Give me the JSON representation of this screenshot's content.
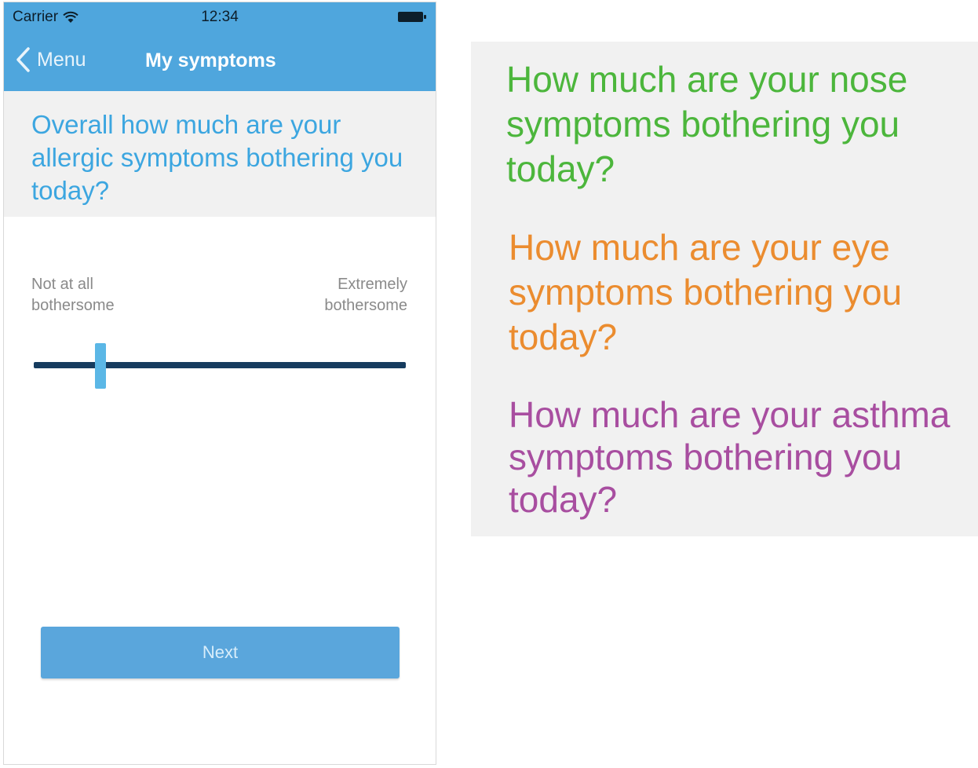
{
  "status_bar": {
    "carrier": "Carrier",
    "time": "12:34",
    "wifi_icon": "wifi-icon",
    "battery_icon": "battery-icon"
  },
  "nav_bar": {
    "back_label": "Menu",
    "back_icon": "chevron-left-icon",
    "title": "My symptoms"
  },
  "question": {
    "text": "Overall how much are your allergic symptoms bothering you today?"
  },
  "slider": {
    "min_label": "Not at all bothersome",
    "max_label": "Extremely bothersome",
    "value_fraction": 0.18
  },
  "next_button": {
    "label": "Next"
  },
  "variants": [
    {
      "text": "How much are your nose symptoms bothering you today?",
      "color": "#4cb63c"
    },
    {
      "text": "How much are your eye symptoms bothering you today?",
      "color": "#eb8c2f"
    },
    {
      "text": "How much are your asthma symptoms bothering you today?",
      "color": "#a84ea0"
    }
  ],
  "colors": {
    "header_blue": "#4fa6dd",
    "question_blue": "#3ca6e0",
    "track_navy": "#163c5f",
    "thumb_blue": "#5bb7e6",
    "button_blue": "#5aa6dc"
  }
}
